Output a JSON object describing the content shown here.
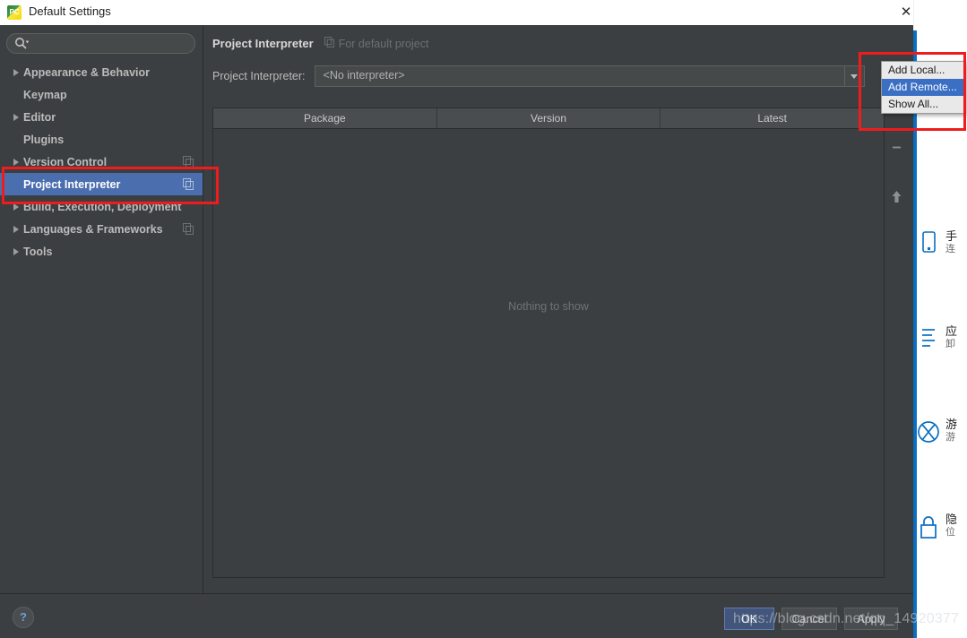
{
  "window": {
    "title": "Default Settings",
    "app_icon": "pycharm-icon",
    "close_label": "✕"
  },
  "sidebar": {
    "search": {
      "placeholder": "",
      "value": "",
      "icon": "search-icon"
    },
    "items": [
      {
        "label": "Appearance & Behavior",
        "expandable": true,
        "selected": false,
        "copy_icon": false
      },
      {
        "label": "Keymap",
        "expandable": false,
        "selected": false,
        "copy_icon": false
      },
      {
        "label": "Editor",
        "expandable": true,
        "selected": false,
        "copy_icon": false
      },
      {
        "label": "Plugins",
        "expandable": false,
        "selected": false,
        "copy_icon": false
      },
      {
        "label": "Version Control",
        "expandable": true,
        "selected": false,
        "copy_icon": true
      },
      {
        "label": "Project Interpreter",
        "expandable": false,
        "selected": true,
        "copy_icon": true
      },
      {
        "label": "Build, Execution, Deployment",
        "expandable": true,
        "selected": false,
        "copy_icon": false
      },
      {
        "label": "Languages & Frameworks",
        "expandable": true,
        "selected": false,
        "copy_icon": true
      },
      {
        "label": "Tools",
        "expandable": true,
        "selected": false,
        "copy_icon": false
      }
    ]
  },
  "content": {
    "header_title": "Project Interpreter",
    "header_scope": "For default project",
    "header_scope_icon": "copy-icon",
    "interpreter_label": "Project Interpreter:",
    "interpreter_value": "<No interpreter>",
    "table": {
      "columns": [
        "Package",
        "Version",
        "Latest"
      ],
      "rows": [],
      "empty_text": "Nothing to show"
    },
    "side_tools": [
      {
        "name": "remove-package-button",
        "glyph": "−"
      },
      {
        "name": "upgrade-package-button",
        "glyph": "↑"
      }
    ]
  },
  "dropdown_menu": {
    "items": [
      {
        "label": "Add Local...",
        "active": false
      },
      {
        "label": "Add Remote...",
        "active": true
      },
      {
        "label": "Show All...",
        "active": false
      }
    ]
  },
  "footer": {
    "help_label": "?",
    "ok_label": "OK",
    "cancel_label": "Cancel",
    "apply_label": "Apply"
  },
  "annotations": {
    "watermark": "https://blog.csdn.net/qq_14920377",
    "highlight_color": "#ee1c1c"
  },
  "background_window": {
    "items": [
      {
        "icon": "phone-icon",
        "title": "手",
        "subtitle": "连"
      },
      {
        "icon": "list-icon",
        "title": "应",
        "subtitle": "卸"
      },
      {
        "icon": "xbox-icon",
        "title": "游",
        "subtitle": "游"
      },
      {
        "icon": "lock-icon",
        "title": "隐",
        "subtitle": "位"
      }
    ]
  }
}
